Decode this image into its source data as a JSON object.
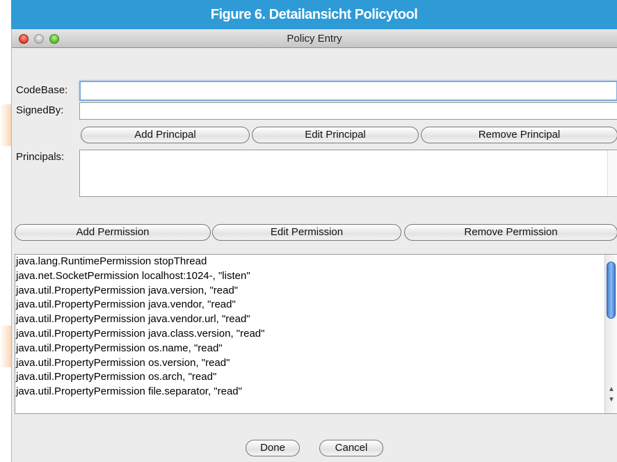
{
  "figure": {
    "label": "Figure 6.",
    "title": "Detailansicht Policytool"
  },
  "window": {
    "title": "Policy Entry"
  },
  "form": {
    "codebase_label": "CodeBase:",
    "codebase_value": "",
    "signedby_label": "SignedBy:",
    "signedby_value": "",
    "principals_label": "Principals:"
  },
  "principal_buttons": {
    "add": "Add Principal",
    "edit": "Edit Principal",
    "remove": "Remove Principal"
  },
  "permission_buttons": {
    "add": "Add Permission",
    "edit": "Edit Permission",
    "remove": "Remove Permission"
  },
  "permissions": [
    "java.lang.RuntimePermission stopThread",
    "java.net.SocketPermission localhost:1024-, \"listen\"",
    "java.util.PropertyPermission java.version, \"read\"",
    "java.util.PropertyPermission java.vendor, \"read\"",
    "java.util.PropertyPermission java.vendor.url, \"read\"",
    "java.util.PropertyPermission java.class.version, \"read\"",
    "java.util.PropertyPermission os.name, \"read\"",
    "java.util.PropertyPermission os.version, \"read\"",
    "java.util.PropertyPermission os.arch, \"read\"",
    "java.util.PropertyPermission file.separator, \"read\""
  ],
  "footer": {
    "done": "Done",
    "cancel": "Cancel"
  },
  "colors": {
    "figure_bar": "#2e9bd7",
    "accent_deco": "#fbd7b8"
  },
  "icons": {
    "close": "close-button-icon",
    "minimize": "minimize-button-icon",
    "zoom": "zoom-button-icon",
    "scroll_up": "scroll-up-arrow-icon",
    "scroll_down": "scroll-down-arrow-icon"
  }
}
